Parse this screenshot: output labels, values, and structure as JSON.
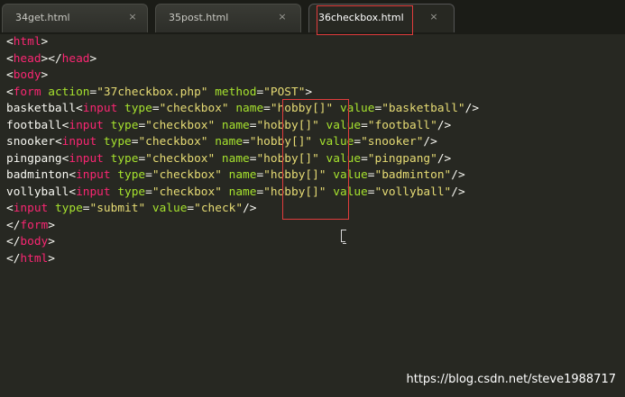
{
  "tabs": [
    {
      "label": "34get.html",
      "close": "×"
    },
    {
      "label": "35post.html",
      "close": "×"
    },
    {
      "label": "36checkbox.html",
      "close": "×"
    }
  ],
  "code": {
    "lines": [
      {
        "segments": [
          {
            "t": "<",
            "c": "tx"
          },
          {
            "t": "html",
            "c": "tg"
          },
          {
            "t": ">",
            "c": "tx"
          }
        ]
      },
      {
        "segments": [
          {
            "t": "<",
            "c": "tx"
          },
          {
            "t": "head",
            "c": "tg"
          },
          {
            "t": "></",
            "c": "tx"
          },
          {
            "t": "head",
            "c": "tg"
          },
          {
            "t": ">",
            "c": "tx"
          }
        ]
      },
      {
        "segments": [
          {
            "t": "<",
            "c": "tx"
          },
          {
            "t": "body",
            "c": "tg"
          },
          {
            "t": ">",
            "c": "tx"
          }
        ]
      },
      {
        "segments": [
          {
            "t": "<",
            "c": "tx"
          },
          {
            "t": "form",
            "c": "tg"
          },
          {
            "t": " ",
            "c": "tx"
          },
          {
            "t": "action",
            "c": "at"
          },
          {
            "t": "=",
            "c": "tx"
          },
          {
            "t": "\"37checkbox.php\"",
            "c": "st"
          },
          {
            "t": " ",
            "c": "tx"
          },
          {
            "t": "method",
            "c": "at"
          },
          {
            "t": "=",
            "c": "tx"
          },
          {
            "t": "\"POST\"",
            "c": "st"
          },
          {
            "t": ">",
            "c": "tx"
          }
        ]
      },
      {
        "segments": [
          {
            "t": "basketball",
            "c": "tx"
          },
          {
            "t": "<",
            "c": "tx"
          },
          {
            "t": "input",
            "c": "tg"
          },
          {
            "t": " ",
            "c": "tx"
          },
          {
            "t": "type",
            "c": "at"
          },
          {
            "t": "=",
            "c": "tx"
          },
          {
            "t": "\"checkbox\"",
            "c": "st"
          },
          {
            "t": " ",
            "c": "tx"
          },
          {
            "t": "name",
            "c": "at"
          },
          {
            "t": "=",
            "c": "tx"
          },
          {
            "t": "\"hobby[]\"",
            "c": "st"
          },
          {
            "t": " ",
            "c": "tx"
          },
          {
            "t": "value",
            "c": "at"
          },
          {
            "t": "=",
            "c": "tx"
          },
          {
            "t": "\"basketball\"",
            "c": "st"
          },
          {
            "t": "/>",
            "c": "tx"
          }
        ]
      },
      {
        "segments": [
          {
            "t": "football",
            "c": "tx"
          },
          {
            "t": "<",
            "c": "tx"
          },
          {
            "t": "input",
            "c": "tg"
          },
          {
            "t": " ",
            "c": "tx"
          },
          {
            "t": "type",
            "c": "at"
          },
          {
            "t": "=",
            "c": "tx"
          },
          {
            "t": "\"checkbox\"",
            "c": "st"
          },
          {
            "t": " ",
            "c": "tx"
          },
          {
            "t": "name",
            "c": "at"
          },
          {
            "t": "=",
            "c": "tx"
          },
          {
            "t": "\"hobby[]\"",
            "c": "st"
          },
          {
            "t": " ",
            "c": "tx"
          },
          {
            "t": "value",
            "c": "at"
          },
          {
            "t": "=",
            "c": "tx"
          },
          {
            "t": "\"football\"",
            "c": "st"
          },
          {
            "t": "/>",
            "c": "tx"
          }
        ]
      },
      {
        "segments": [
          {
            "t": "snooker",
            "c": "tx"
          },
          {
            "t": "<",
            "c": "tx"
          },
          {
            "t": "input",
            "c": "tg"
          },
          {
            "t": " ",
            "c": "tx"
          },
          {
            "t": "type",
            "c": "at"
          },
          {
            "t": "=",
            "c": "tx"
          },
          {
            "t": "\"checkbox\"",
            "c": "st"
          },
          {
            "t": " ",
            "c": "tx"
          },
          {
            "t": "name",
            "c": "at"
          },
          {
            "t": "=",
            "c": "tx"
          },
          {
            "t": "\"hobby[]\"",
            "c": "st"
          },
          {
            "t": " ",
            "c": "tx"
          },
          {
            "t": "value",
            "c": "at"
          },
          {
            "t": "=",
            "c": "tx"
          },
          {
            "t": "\"snooker\"",
            "c": "st"
          },
          {
            "t": "/>",
            "c": "tx"
          }
        ]
      },
      {
        "segments": [
          {
            "t": "pingpang",
            "c": "tx"
          },
          {
            "t": "<",
            "c": "tx"
          },
          {
            "t": "input",
            "c": "tg"
          },
          {
            "t": " ",
            "c": "tx"
          },
          {
            "t": "type",
            "c": "at"
          },
          {
            "t": "=",
            "c": "tx"
          },
          {
            "t": "\"checkbox\"",
            "c": "st"
          },
          {
            "t": " ",
            "c": "tx"
          },
          {
            "t": "name",
            "c": "at"
          },
          {
            "t": "=",
            "c": "tx"
          },
          {
            "t": "\"hobby[]\"",
            "c": "st"
          },
          {
            "t": " ",
            "c": "tx"
          },
          {
            "t": "value",
            "c": "at"
          },
          {
            "t": "=",
            "c": "tx"
          },
          {
            "t": "\"pingpang\"",
            "c": "st"
          },
          {
            "t": "/>",
            "c": "tx"
          }
        ]
      },
      {
        "segments": [
          {
            "t": "badminton",
            "c": "tx"
          },
          {
            "t": "<",
            "c": "tx"
          },
          {
            "t": "input",
            "c": "tg"
          },
          {
            "t": " ",
            "c": "tx"
          },
          {
            "t": "type",
            "c": "at"
          },
          {
            "t": "=",
            "c": "tx"
          },
          {
            "t": "\"checkbox\"",
            "c": "st"
          },
          {
            "t": " ",
            "c": "tx"
          },
          {
            "t": "name",
            "c": "at"
          },
          {
            "t": "=",
            "c": "tx"
          },
          {
            "t": "\"hobby[]\"",
            "c": "st"
          },
          {
            "t": " ",
            "c": "tx"
          },
          {
            "t": "value",
            "c": "at"
          },
          {
            "t": "=",
            "c": "tx"
          },
          {
            "t": "\"badminton\"",
            "c": "st"
          },
          {
            "t": "/>",
            "c": "tx"
          }
        ]
      },
      {
        "segments": [
          {
            "t": "vollyball",
            "c": "tx"
          },
          {
            "t": "<",
            "c": "tx"
          },
          {
            "t": "input",
            "c": "tg"
          },
          {
            "t": " ",
            "c": "tx"
          },
          {
            "t": "type",
            "c": "at"
          },
          {
            "t": "=",
            "c": "tx"
          },
          {
            "t": "\"checkbox\"",
            "c": "st"
          },
          {
            "t": " ",
            "c": "tx"
          },
          {
            "t": "name",
            "c": "at"
          },
          {
            "t": "=",
            "c": "tx"
          },
          {
            "t": "\"hobby[]\"",
            "c": "st"
          },
          {
            "t": " ",
            "c": "tx"
          },
          {
            "t": "value",
            "c": "at"
          },
          {
            "t": "=",
            "c": "tx"
          },
          {
            "t": "\"vollyball\"",
            "c": "st"
          },
          {
            "t": "/>",
            "c": "tx"
          }
        ]
      },
      {
        "segments": [
          {
            "t": "<",
            "c": "tx"
          },
          {
            "t": "input",
            "c": "tg"
          },
          {
            "t": " ",
            "c": "tx"
          },
          {
            "t": "type",
            "c": "at"
          },
          {
            "t": "=",
            "c": "tx"
          },
          {
            "t": "\"submit\"",
            "c": "st"
          },
          {
            "t": " ",
            "c": "tx"
          },
          {
            "t": "value",
            "c": "at"
          },
          {
            "t": "=",
            "c": "tx"
          },
          {
            "t": "\"check\"",
            "c": "st"
          },
          {
            "t": "/>",
            "c": "tx"
          }
        ]
      },
      {
        "segments": [
          {
            "t": "</",
            "c": "tx"
          },
          {
            "t": "form",
            "c": "tg"
          },
          {
            "t": ">",
            "c": "tx"
          }
        ]
      },
      {
        "segments": [
          {
            "t": "</",
            "c": "tx"
          },
          {
            "t": "body",
            "c": "tg"
          },
          {
            "t": ">",
            "c": "tx"
          }
        ]
      },
      {
        "segments": [
          {
            "t": "</",
            "c": "tx"
          },
          {
            "t": "html",
            "c": "tg"
          },
          {
            "t": ">",
            "c": "tx"
          }
        ]
      }
    ]
  },
  "watermark": "https://blog.csdn.net/steve1988717",
  "colors": {
    "background": "#272822",
    "tag": "#f92672",
    "attribute": "#a6e22e",
    "string": "#e6db74",
    "annotation": "#e03c3c"
  }
}
